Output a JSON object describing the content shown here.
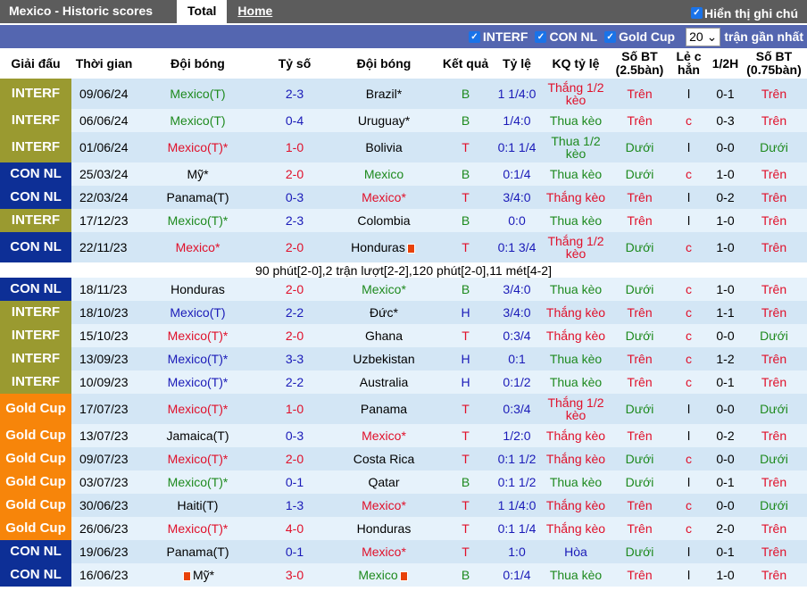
{
  "topbar": {
    "title": "Mexico - Historic scores",
    "tabs": [
      "Total",
      "Home"
    ],
    "show_notes": "Hiển thị ghi chú"
  },
  "filters": {
    "items": [
      "INTERF",
      "CON NL",
      "Gold Cup"
    ],
    "count": "20",
    "count_suffix": "trận gần nhất"
  },
  "league_colors": {
    "INTERF": "#9a9a30",
    "CON NL": "#0d2f96",
    "Gold Cup": "#f7850a"
  },
  "headers": [
    "Giải đấu",
    "Thời gian",
    "Đội bóng",
    "Tỷ số",
    "Đội bóng",
    "Kết quả",
    "Tỷ lệ",
    "KQ tỷ lệ",
    "Số BT (2.5bàn)",
    "Lẻ c hẳn",
    "1/2H",
    "Số BT (0.75bàn)"
  ],
  "rows": [
    {
      "league": "INTERF",
      "date": "09/06/24",
      "home": "Mexico(T)",
      "hc": "green",
      "score": "2-3",
      "sc": "blue",
      "away": "Brazil*",
      "ac": "black",
      "res": "B",
      "rc": "green",
      "hcp": "1 1/4:0",
      "kq": "Thắng 1/2 kèo",
      "kc": "red",
      "bt": "Trên",
      "btc": "red",
      "lc": "l",
      "lcc": "black",
      "half": "0-1",
      "bt2": "Trên",
      "bt2c": "red",
      "tall": true
    },
    {
      "league": "INTERF",
      "date": "06/06/24",
      "home": "Mexico(T)",
      "hc": "green",
      "score": "0-4",
      "sc": "blue",
      "away": "Uruguay*",
      "ac": "black",
      "res": "B",
      "rc": "green",
      "hcp": "1/4:0",
      "kq": "Thua kèo",
      "kc": "green",
      "bt": "Trên",
      "btc": "red",
      "lc": "c",
      "lcc": "red",
      "half": "0-3",
      "bt2": "Trên",
      "bt2c": "red"
    },
    {
      "league": "INTERF",
      "date": "01/06/24",
      "home": "Mexico(T)*",
      "hc": "red",
      "score": "1-0",
      "sc": "red",
      "away": "Bolivia",
      "ac": "black",
      "res": "T",
      "rc": "red",
      "hcp": "0:1 1/4",
      "kq": "Thua 1/2 kèo",
      "kc": "green",
      "bt": "Dưới",
      "btc": "green",
      "lc": "l",
      "lcc": "black",
      "half": "0-0",
      "bt2": "Dưới",
      "bt2c": "green",
      "tall": true
    },
    {
      "league": "CON NL",
      "date": "25/03/24",
      "home": "Mỹ*",
      "hc": "black",
      "score": "2-0",
      "sc": "red",
      "away": "Mexico",
      "ac": "green",
      "res": "B",
      "rc": "green",
      "hcp": "0:1/4",
      "kq": "Thua kèo",
      "kc": "green",
      "bt": "Dưới",
      "btc": "green",
      "lc": "c",
      "lcc": "red",
      "half": "1-0",
      "bt2": "Trên",
      "bt2c": "red"
    },
    {
      "league": "CON NL",
      "date": "22/03/24",
      "home": "Panama(T)",
      "hc": "black",
      "score": "0-3",
      "sc": "blue",
      "away": "Mexico*",
      "ac": "red",
      "res": "T",
      "rc": "red",
      "hcp": "3/4:0",
      "kq": "Thắng kèo",
      "kc": "red",
      "bt": "Trên",
      "btc": "red",
      "lc": "l",
      "lcc": "black",
      "half": "0-2",
      "bt2": "Trên",
      "bt2c": "red"
    },
    {
      "league": "INTERF",
      "date": "17/12/23",
      "home": "Mexico(T)*",
      "hc": "green",
      "score": "2-3",
      "sc": "blue",
      "away": "Colombia",
      "ac": "black",
      "res": "B",
      "rc": "green",
      "hcp": "0:0",
      "kq": "Thua kèo",
      "kc": "green",
      "bt": "Trên",
      "btc": "red",
      "lc": "l",
      "lcc": "black",
      "half": "1-0",
      "bt2": "Trên",
      "bt2c": "red"
    },
    {
      "league": "CON NL",
      "date": "22/11/23",
      "home": "Mexico*",
      "hc": "red",
      "score": "2-0",
      "sc": "red",
      "away": "Honduras",
      "ac": "black",
      "away_flag": true,
      "res": "T",
      "rc": "red",
      "hcp": "0:1 3/4",
      "kq": "Thắng 1/2 kèo",
      "kc": "red",
      "bt": "Dưới",
      "btc": "green",
      "lc": "c",
      "lcc": "red",
      "half": "1-0",
      "bt2": "Trên",
      "bt2c": "red",
      "tall": true,
      "note": "90 phút[2-0],2 trận lượt[2-2],120 phút[2-0],11 mét[4-2]"
    },
    {
      "league": "CON NL",
      "date": "18/11/23",
      "home": "Honduras",
      "hc": "black",
      "score": "2-0",
      "sc": "red",
      "away": "Mexico*",
      "ac": "green",
      "res": "B",
      "rc": "green",
      "hcp": "3/4:0",
      "kq": "Thua kèo",
      "kc": "green",
      "bt": "Dưới",
      "btc": "green",
      "lc": "c",
      "lcc": "red",
      "half": "1-0",
      "bt2": "Trên",
      "bt2c": "red"
    },
    {
      "league": "INTERF",
      "date": "18/10/23",
      "home": "Mexico(T)",
      "hc": "blue",
      "score": "2-2",
      "sc": "blue",
      "away": "Đức*",
      "ac": "black",
      "res": "H",
      "rc": "blue",
      "hcp": "3/4:0",
      "kq": "Thắng kèo",
      "kc": "red",
      "bt": "Trên",
      "btc": "red",
      "lc": "c",
      "lcc": "red",
      "half": "1-1",
      "bt2": "Trên",
      "bt2c": "red"
    },
    {
      "league": "INTERF",
      "date": "15/10/23",
      "home": "Mexico(T)*",
      "hc": "red",
      "score": "2-0",
      "sc": "red",
      "away": "Ghana",
      "ac": "black",
      "res": "T",
      "rc": "red",
      "hcp": "0:3/4",
      "kq": "Thắng kèo",
      "kc": "red",
      "bt": "Dưới",
      "btc": "green",
      "lc": "c",
      "lcc": "red",
      "half": "0-0",
      "bt2": "Dưới",
      "bt2c": "green"
    },
    {
      "league": "INTERF",
      "date": "13/09/23",
      "home": "Mexico(T)*",
      "hc": "blue",
      "score": "3-3",
      "sc": "blue",
      "away": "Uzbekistan",
      "ac": "black",
      "res": "H",
      "rc": "blue",
      "hcp": "0:1",
      "kq": "Thua kèo",
      "kc": "green",
      "bt": "Trên",
      "btc": "red",
      "lc": "c",
      "lcc": "red",
      "half": "1-2",
      "bt2": "Trên",
      "bt2c": "red"
    },
    {
      "league": "INTERF",
      "date": "10/09/23",
      "home": "Mexico(T)*",
      "hc": "blue",
      "score": "2-2",
      "sc": "blue",
      "away": "Australia",
      "ac": "black",
      "res": "H",
      "rc": "blue",
      "hcp": "0:1/2",
      "kq": "Thua kèo",
      "kc": "green",
      "bt": "Trên",
      "btc": "red",
      "lc": "c",
      "lcc": "red",
      "half": "0-1",
      "bt2": "Trên",
      "bt2c": "red"
    },
    {
      "league": "Gold Cup",
      "date": "17/07/23",
      "home": "Mexico(T)*",
      "hc": "red",
      "score": "1-0",
      "sc": "red",
      "away": "Panama",
      "ac": "black",
      "res": "T",
      "rc": "red",
      "hcp": "0:3/4",
      "kq": "Thắng 1/2 kèo",
      "kc": "red",
      "bt": "Dưới",
      "btc": "green",
      "lc": "l",
      "lcc": "black",
      "half": "0-0",
      "bt2": "Dưới",
      "bt2c": "green",
      "tall": true
    },
    {
      "league": "Gold Cup",
      "date": "13/07/23",
      "home": "Jamaica(T)",
      "hc": "black",
      "score": "0-3",
      "sc": "blue",
      "away": "Mexico*",
      "ac": "red",
      "res": "T",
      "rc": "red",
      "hcp": "1/2:0",
      "kq": "Thắng kèo",
      "kc": "red",
      "bt": "Trên",
      "btc": "red",
      "lc": "l",
      "lcc": "black",
      "half": "0-2",
      "bt2": "Trên",
      "bt2c": "red"
    },
    {
      "league": "Gold Cup",
      "date": "09/07/23",
      "home": "Mexico(T)*",
      "hc": "red",
      "score": "2-0",
      "sc": "red",
      "away": "Costa Rica",
      "ac": "black",
      "res": "T",
      "rc": "red",
      "hcp": "0:1 1/2",
      "kq": "Thắng kèo",
      "kc": "red",
      "bt": "Dưới",
      "btc": "green",
      "lc": "c",
      "lcc": "red",
      "half": "0-0",
      "bt2": "Dưới",
      "bt2c": "green"
    },
    {
      "league": "Gold Cup",
      "date": "03/07/23",
      "home": "Mexico(T)*",
      "hc": "green",
      "score": "0-1",
      "sc": "blue",
      "away": "Qatar",
      "ac": "black",
      "res": "B",
      "rc": "green",
      "hcp": "0:1 1/2",
      "kq": "Thua kèo",
      "kc": "green",
      "bt": "Dưới",
      "btc": "green",
      "lc": "l",
      "lcc": "black",
      "half": "0-1",
      "bt2": "Trên",
      "bt2c": "red"
    },
    {
      "league": "Gold Cup",
      "date": "30/06/23",
      "home": "Haiti(T)",
      "hc": "black",
      "score": "1-3",
      "sc": "blue",
      "away": "Mexico*",
      "ac": "red",
      "res": "T",
      "rc": "red",
      "hcp": "1 1/4:0",
      "kq": "Thắng kèo",
      "kc": "red",
      "bt": "Trên",
      "btc": "red",
      "lc": "c",
      "lcc": "red",
      "half": "0-0",
      "bt2": "Dưới",
      "bt2c": "green"
    },
    {
      "league": "Gold Cup",
      "date": "26/06/23",
      "home": "Mexico(T)*",
      "hc": "red",
      "score": "4-0",
      "sc": "red",
      "away": "Honduras",
      "ac": "black",
      "res": "T",
      "rc": "red",
      "hcp": "0:1 1/4",
      "kq": "Thắng kèo",
      "kc": "red",
      "bt": "Trên",
      "btc": "red",
      "lc": "c",
      "lcc": "red",
      "half": "2-0",
      "bt2": "Trên",
      "bt2c": "red"
    },
    {
      "league": "CON NL",
      "date": "19/06/23",
      "home": "Panama(T)",
      "hc": "black",
      "score": "0-1",
      "sc": "blue",
      "away": "Mexico*",
      "ac": "red",
      "res": "T",
      "rc": "red",
      "hcp": "1:0",
      "kq": "Hòa",
      "kc": "blue",
      "bt": "Dưới",
      "btc": "green",
      "lc": "l",
      "lcc": "black",
      "half": "0-1",
      "bt2": "Trên",
      "bt2c": "red"
    },
    {
      "league": "CON NL",
      "date": "16/06/23",
      "home": "Mỹ*",
      "hc": "black",
      "home_flag": true,
      "score": "3-0",
      "sc": "red",
      "away": "Mexico",
      "ac": "green",
      "away_flag": true,
      "res": "B",
      "rc": "green",
      "hcp": "0:1/4",
      "kq": "Thua kèo",
      "kc": "green",
      "bt": "Trên",
      "btc": "red",
      "lc": "l",
      "lcc": "black",
      "half": "1-0",
      "bt2": "Trên",
      "bt2c": "red"
    }
  ]
}
